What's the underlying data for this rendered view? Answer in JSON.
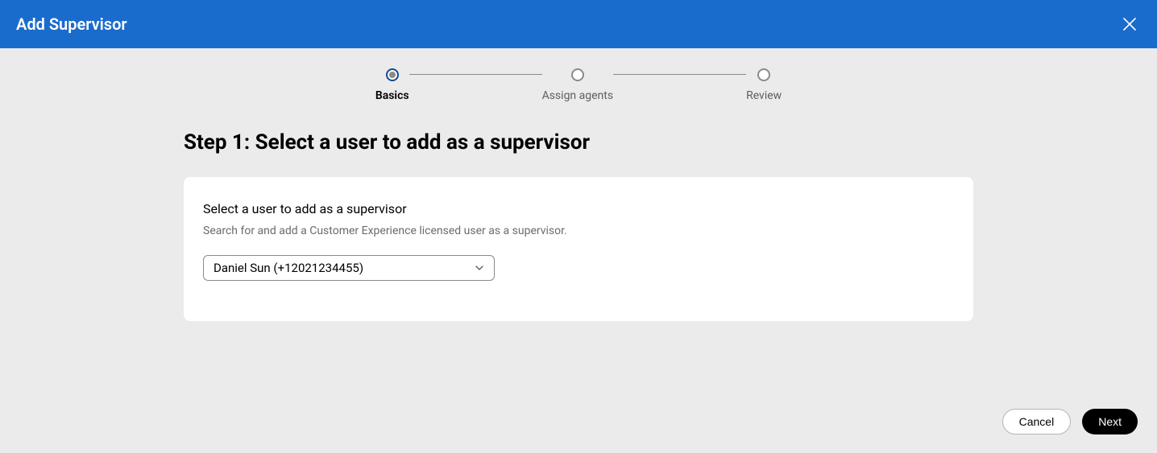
{
  "header": {
    "title": "Add Supervisor"
  },
  "stepper": {
    "steps": [
      {
        "label": "Basics",
        "active": true
      },
      {
        "label": "Assign agents",
        "active": false
      },
      {
        "label": "Review",
        "active": false
      }
    ]
  },
  "main": {
    "title": "Step 1: Select a user to add as a supervisor",
    "card": {
      "title": "Select a user to add as a supervisor",
      "subtitle": "Search for and add a Customer Experience licensed user as a supervisor.",
      "dropdown": {
        "value": "Daniel Sun (+12021234455)"
      }
    }
  },
  "footer": {
    "cancel_label": "Cancel",
    "next_label": "Next"
  }
}
